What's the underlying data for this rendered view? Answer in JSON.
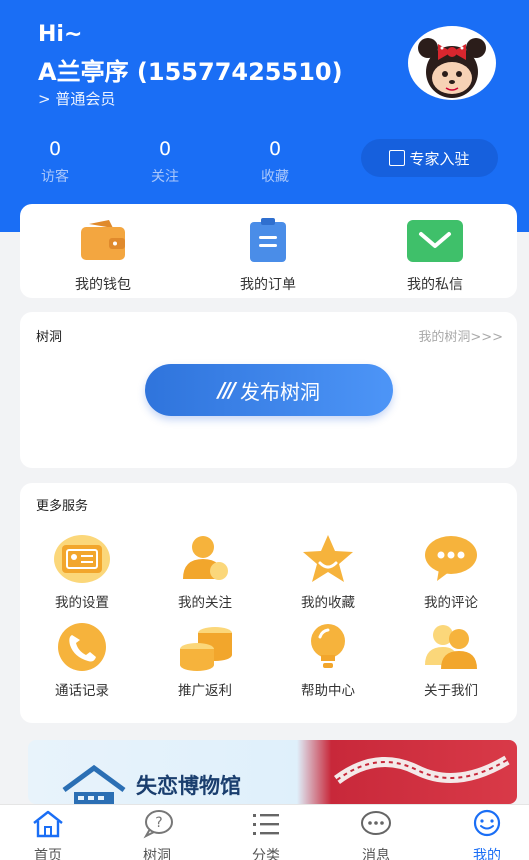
{
  "header": {
    "greeting": "Hi~",
    "username": "A兰亭序 (15577425510)",
    "member_level": "> 普通会员",
    "stats": [
      {
        "value": "0",
        "label": "访客"
      },
      {
        "value": "0",
        "label": "关注"
      },
      {
        "value": "0",
        "label": "收藏"
      }
    ],
    "expert_button": "专家入驻",
    "colors": {
      "brand": "#1a6ef5"
    }
  },
  "quick_actions": [
    {
      "label": "我的钱包",
      "icon": "wallet-icon"
    },
    {
      "label": "我的订单",
      "icon": "order-icon"
    },
    {
      "label": "我的私信",
      "icon": "mail-icon"
    }
  ],
  "tree_hole": {
    "title": "树洞",
    "link": "我的树洞>>>",
    "publish_slashes": "///",
    "publish_label": "发布树洞"
  },
  "services": {
    "title": "更多服务",
    "items": [
      {
        "label": "我的设置",
        "icon": "id-card-icon"
      },
      {
        "label": "我的关注",
        "icon": "user-follow-icon"
      },
      {
        "label": "我的收藏",
        "icon": "star-icon"
      },
      {
        "label": "我的评论",
        "icon": "comment-icon"
      },
      {
        "label": "通话记录",
        "icon": "phone-icon"
      },
      {
        "label": "推广返利",
        "icon": "coins-icon"
      },
      {
        "label": "帮助中心",
        "icon": "lightbulb-icon"
      },
      {
        "label": "关于我们",
        "icon": "team-icon"
      }
    ]
  },
  "banner": {
    "title": "失恋博物馆"
  },
  "tabbar": {
    "items": [
      {
        "label": "首页",
        "icon": "home-icon"
      },
      {
        "label": "树洞",
        "icon": "question-bubble-icon"
      },
      {
        "label": "分类",
        "icon": "category-list-icon"
      },
      {
        "label": "消息",
        "icon": "message-icon"
      },
      {
        "label": "我的",
        "icon": "profile-icon"
      }
    ],
    "active": "我的",
    "colors": {
      "active": "#1a6ef5",
      "inactive": "#555555"
    }
  }
}
